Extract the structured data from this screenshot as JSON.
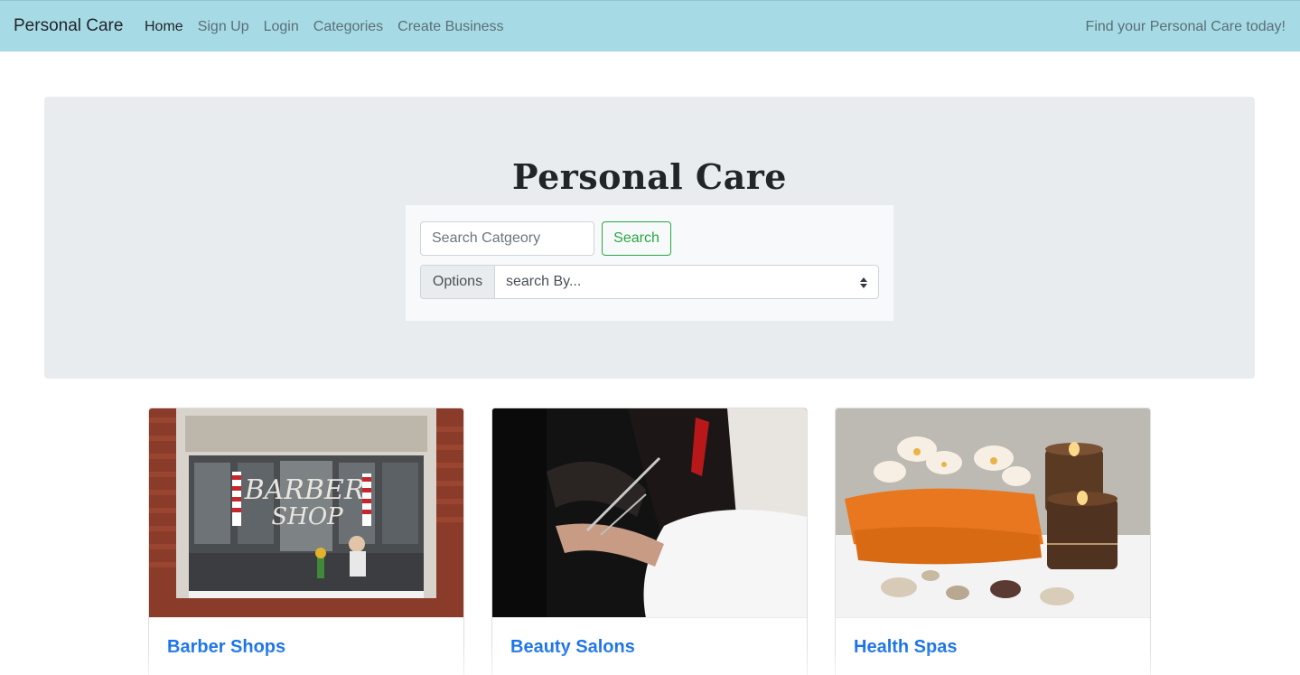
{
  "navbar": {
    "brand": "Personal Care",
    "links": [
      {
        "label": "Home",
        "active": true
      },
      {
        "label": "Sign Up",
        "active": false
      },
      {
        "label": "Login",
        "active": false
      },
      {
        "label": "Categories",
        "active": false
      },
      {
        "label": "Create Business",
        "active": false
      }
    ],
    "tagline": "Find your Personal Care today!"
  },
  "hero": {
    "title": "Personal Care",
    "search": {
      "placeholder": "Search Catgeory",
      "value": "",
      "button_label": "Search"
    },
    "options": {
      "label": "Options",
      "selected": "search By..."
    }
  },
  "cards": [
    {
      "title": "Barber Shops",
      "image": "barber-shop-storefront"
    },
    {
      "title": "Beauty Salons",
      "image": "hair-cutting-scissors"
    },
    {
      "title": "Health Spas",
      "image": "spa-orchids-towels-candles"
    }
  ],
  "colors": {
    "navbar_bg": "#a6dbe6",
    "jumbotron_bg": "#e9ecef",
    "success": "#28a745",
    "link": "#1a73e8"
  }
}
